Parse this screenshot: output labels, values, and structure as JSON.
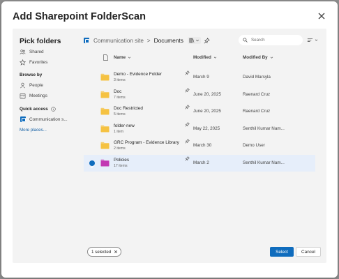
{
  "dialog": {
    "title": "Add Sharepoint FolderScan"
  },
  "sidebar": {
    "title": "Pick folders",
    "items": [
      {
        "label": "Shared",
        "icon": "people-icon"
      },
      {
        "label": "Favorites",
        "icon": "star-icon"
      }
    ],
    "browse_by": {
      "heading": "Browse by",
      "items": [
        {
          "label": "People",
          "icon": "person-icon"
        },
        {
          "label": "Meetings",
          "icon": "calendar-icon"
        }
      ]
    },
    "quick_access": {
      "heading": "Quick access",
      "items": [
        {
          "label": "Communication s..."
        }
      ],
      "more_link": "More places..."
    }
  },
  "breadcrumb": {
    "site": "Communication site",
    "separator": ">",
    "current": "Documents"
  },
  "search": {
    "placeholder": "Search"
  },
  "list": {
    "columns": {
      "name": "Name",
      "modified": "Modified",
      "modified_by": "Modified By"
    },
    "rows": [
      {
        "name": "Demo - Evidence Folder",
        "count": "3 items",
        "modified": "March 9",
        "by": "David Marsyla",
        "selected": false,
        "folder_color": "#f5c242"
      },
      {
        "name": "Doc",
        "count": "7 items",
        "modified": "June 20, 2025",
        "by": "Raenard Cruz",
        "selected": false,
        "folder_color": "#f5c242"
      },
      {
        "name": "Doc Restricted",
        "count": "5 items",
        "modified": "June 20, 2025",
        "by": "Raenard Cruz",
        "selected": false,
        "folder_color": "#f5c242"
      },
      {
        "name": "folder-new",
        "count": "1 item",
        "modified": "May 22, 2025",
        "by": "Senthil Kumar Nam...",
        "selected": false,
        "folder_color": "#f5c242"
      },
      {
        "name": "GRC Program - Evidence Library",
        "count": "2 items",
        "modified": "March 30",
        "by": "Demo User",
        "selected": false,
        "folder_color": "#f5c242"
      },
      {
        "name": "Policies",
        "count": "17 items",
        "modified": "March 2",
        "by": "Senthil Kumar Nam...",
        "selected": true,
        "folder_color": "#c239b3"
      }
    ]
  },
  "footer": {
    "selected_chip": "1 selected",
    "select_label": "Select",
    "cancel_label": "Cancel"
  },
  "colors": {
    "accent": "#0f6cbd",
    "selected_row": "#e6eefa",
    "picker_bg": "#f3f3f3"
  }
}
